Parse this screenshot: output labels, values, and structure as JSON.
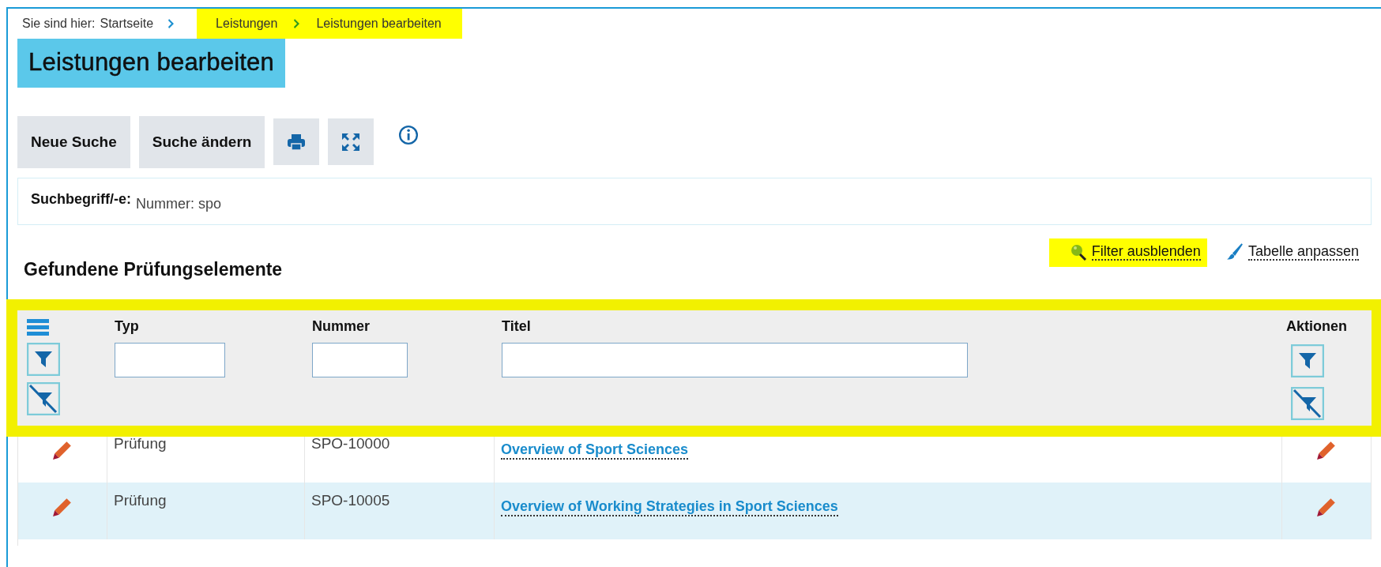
{
  "breadcrumb": {
    "label": "Sie sind hier:",
    "items": [
      {
        "text": "Startseite",
        "highlighted": false
      },
      {
        "text": "Leistungen",
        "highlighted": true
      },
      {
        "text": "Leistungen bearbeiten",
        "highlighted": true
      }
    ]
  },
  "page_title": "Leistungen bearbeiten",
  "toolbar": [
    {
      "kind": "text",
      "label": "Neue Suche"
    },
    {
      "kind": "text",
      "label": "Suche ändern"
    },
    {
      "kind": "print"
    },
    {
      "kind": "expand"
    },
    {
      "kind": "info"
    }
  ],
  "search_summary": {
    "label": "Suchbegriff/-e:",
    "value": "Nummer: spo"
  },
  "results": {
    "title": "Gefundene Prüfungselemente",
    "links": [
      {
        "kind": "filter",
        "label": "Filter ausblenden",
        "highlighted": true
      },
      {
        "kind": "customize",
        "label": "Tabelle anpassen",
        "highlighted": false
      }
    ],
    "table": {
      "filter_row_highlighted": true,
      "columns": [
        {
          "label": "Typ",
          "kind": "filter"
        },
        {
          "label": "Nummer",
          "kind": "filter"
        },
        {
          "label": "Titel",
          "kind": "filter"
        },
        {
          "label": "Aktionen",
          "kind": "actions"
        }
      ],
      "rows": [
        {
          "typ": "Prüfung",
          "nummer": "SPO-10000",
          "titel": "Overview of Sport Sciences"
        },
        {
          "typ": "Prüfung",
          "nummer": "SPO-10005",
          "titel": "Overview of Working Strategies in Sport Sciences"
        }
      ]
    }
  }
}
